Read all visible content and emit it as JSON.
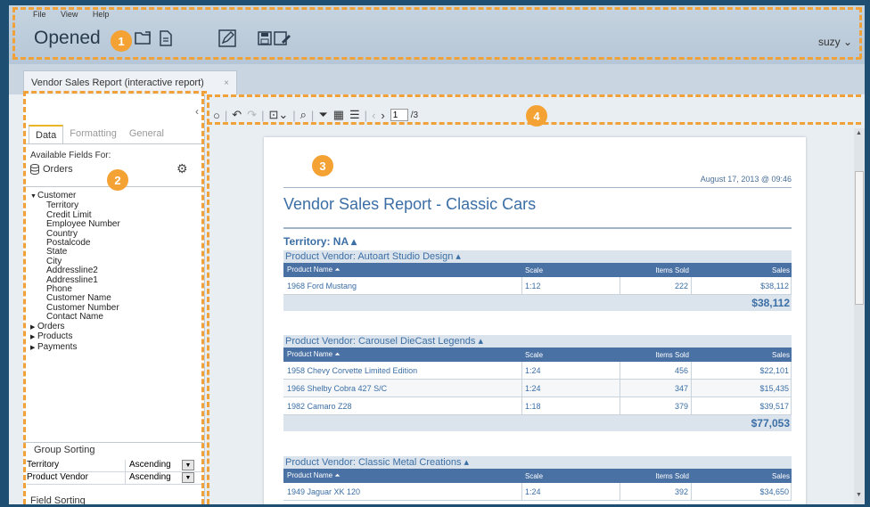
{
  "header": {
    "menu": [
      "File",
      "View",
      "Help"
    ],
    "opened_label": "Opened",
    "user": "suzy ⌄"
  },
  "tabs": [
    {
      "label": "Vendor Sales Report (interactive report)",
      "close": "×"
    }
  ],
  "left_panel": {
    "collapse": "‹",
    "tabs": [
      "Data",
      "Formatting",
      "General"
    ],
    "available_label": "Available Fields For:",
    "source": "Orders",
    "fields": [
      {
        "label": "Customer",
        "expanded": true,
        "children": [
          "Territory",
          "Credit Limit",
          "Employee Number",
          "Country",
          "Postalcode",
          "State",
          "City",
          "Addressline2",
          "Addressline1",
          "Phone",
          "Customer Name",
          "Customer Number",
          "Contact Name"
        ]
      },
      {
        "label": "Orders"
      },
      {
        "label": "Products"
      },
      {
        "label": "Payments"
      }
    ],
    "group_sorting_label": "Group Sorting",
    "group_sorting": [
      {
        "field": "Territory",
        "order": "Ascending"
      },
      {
        "field": "Product Vendor",
        "order": "Ascending"
      }
    ],
    "field_sorting_label": "Field Sorting"
  },
  "toolbar": {
    "page_value": "1",
    "page_total": "/3"
  },
  "report": {
    "timestamp": "August 17, 2013 @ 09:46",
    "title": "Vendor Sales Report - Classic Cars",
    "territory": "Territory: NA ▴",
    "columns": [
      "Product Name ⏶",
      "Scale",
      "Items Sold",
      "Sales"
    ],
    "vendors": [
      {
        "name": "Product Vendor: Autoart Studio Design ▴",
        "rows": [
          [
            "1968 Ford Mustang",
            "1:12",
            "222",
            "$38,112"
          ]
        ],
        "total": "$38,112"
      },
      {
        "name": "Product Vendor: Carousel DieCast Legends ▴",
        "rows": [
          [
            "1958 Chevy Corvette Limited Edition",
            "1:24",
            "456",
            "$22,101"
          ],
          [
            "1966 Shelby Cobra 427 S/C",
            "1:24",
            "347",
            "$15,435"
          ],
          [
            "1982 Camaro Z28",
            "1:18",
            "379",
            "$39,517"
          ]
        ],
        "total": "$77,053"
      },
      {
        "name": "Product Vendor: Classic Metal Creations ▴",
        "rows": [
          [
            "1949 Jaguar XK 120",
            "1:24",
            "392",
            "$34,650"
          ]
        ],
        "total": ""
      }
    ]
  },
  "callouts": [
    "1",
    "2",
    "3",
    "4"
  ],
  "colors": {
    "callout": "#f3a233",
    "header_blue": "#4a71a4",
    "accent": "#3b6ea5"
  }
}
